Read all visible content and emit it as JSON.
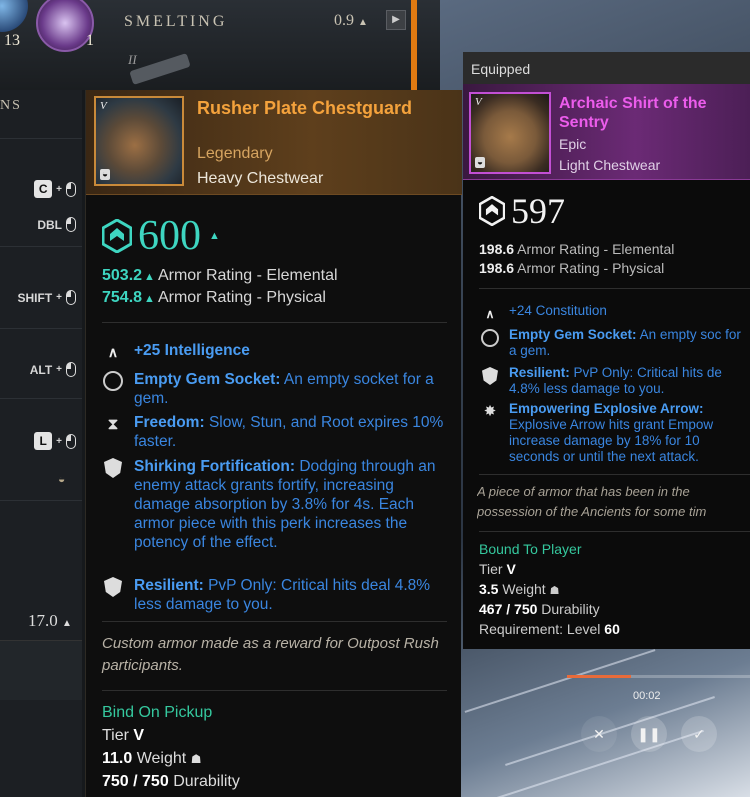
{
  "top_bar": {
    "resource_counts": [
      "13",
      "1"
    ],
    "smelting_label": "SMELTING",
    "smelting_value": "0.9",
    "sub_label": "II"
  },
  "left_panel": {
    "header_fragment": "NS",
    "keybinds": [
      {
        "key": "C",
        "mouse": true
      },
      {
        "key": "DBL",
        "mouse": true
      },
      {
        "key": "SHIFT",
        "mouse": true
      },
      {
        "key": "ALT",
        "mouse": true
      },
      {
        "key": "L",
        "mouse": true
      }
    ],
    "weight_value": "17.0"
  },
  "main_item": {
    "name": "Rusher Plate Chestguard",
    "tier_badge": "V",
    "rarity": "Legendary",
    "slot": "Heavy Chestwear",
    "gear_score": "600",
    "armor": [
      {
        "value": "503.2",
        "label": "Armor Rating - Elemental"
      },
      {
        "value": "754.8",
        "label": "Armor Rating - Physical"
      }
    ],
    "attribute": {
      "name": "+25 Intelligence"
    },
    "perks": [
      {
        "title": "Empty Gem Socket:",
        "desc": "An empty socket for a gem."
      },
      {
        "title": "Freedom:",
        "desc": "Slow, Stun, and Root expires 10% faster."
      },
      {
        "title": "Shirking Fortification:",
        "desc": "Dodging through an enemy attack grants fortify, increasing damage absorption by 3.8% for 4s. Each armor piece with this perk increases the potency of the effect."
      },
      {
        "title": "Resilient:",
        "desc": "PvP Only: Critical hits deal 4.8% less damage to you."
      }
    ],
    "flavor": "Custom armor made as a reward for Outpost Rush participants.",
    "bind": "Bind On Pickup",
    "tier_label": "Tier",
    "tier_value": "V",
    "weight_value": "11.0",
    "weight_label": "Weight",
    "durability_value": "750 / 750",
    "durability_label": "Durability"
  },
  "equipped_item": {
    "section_label": "Equipped",
    "name": "Archaic Shirt of the Sentry",
    "tier_badge": "V",
    "rarity": "Epic",
    "slot": "Light Chestwear",
    "gear_score": "597",
    "armor": [
      {
        "value": "198.6",
        "label": "Armor Rating - Elemental"
      },
      {
        "value": "198.6",
        "label": "Armor Rating - Physical"
      }
    ],
    "attribute": {
      "name": "+24 Constitution"
    },
    "perks": [
      {
        "title": "Empty Gem Socket:",
        "desc": "An empty soc for a gem."
      },
      {
        "title": "Resilient:",
        "desc": "PvP Only: Critical hits de 4.8% less damage to you."
      },
      {
        "title": "Empowering Explosive Arrow:",
        "desc": "Explosive Arrow hits grant Empow increase damage by 18% for 10 seconds or until the next attack."
      }
    ],
    "flavor_lines": [
      "A piece of armor that has been in the",
      "possession of the Ancients for some tim"
    ],
    "bind": "Bound To Player",
    "tier_label": "Tier",
    "tier_value": "V",
    "weight_value": "3.5",
    "weight_label": "Weight",
    "durability_value": "467 / 750",
    "durability_label": "Durability",
    "requirement_label": "Requirement: Level",
    "requirement_value": "60"
  },
  "video_overlay": {
    "time": "00:02",
    "progress": 0.35
  },
  "colors": {
    "gear_score": "#3ed6c1",
    "legendary": "#f4a23c",
    "epic": "#ec5cec",
    "perk_blue": "#3a86e0",
    "bind_green": "#35c89e"
  }
}
